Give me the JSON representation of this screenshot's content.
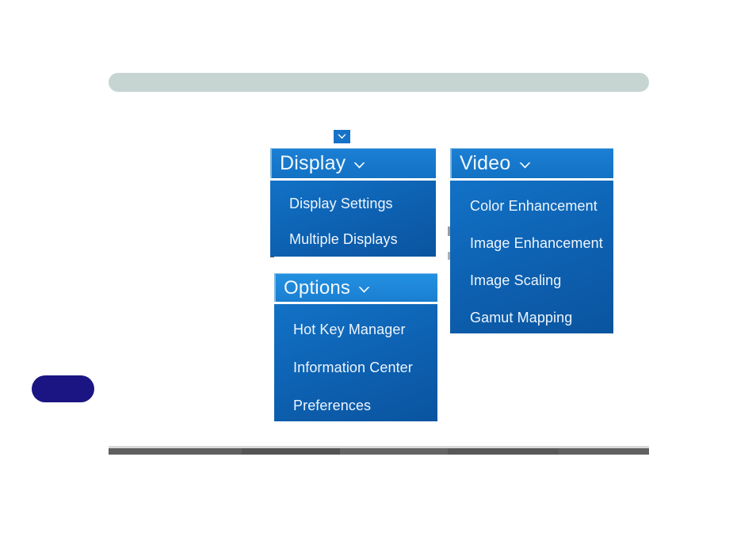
{
  "page": {
    "background_color": "#ffffff",
    "top_bar": {
      "color": "#c6d5d2",
      "label": ""
    },
    "bottom_rule": {
      "color": "#5a5a5a"
    },
    "nav_pill": {
      "color": "#1b1583",
      "label": ""
    }
  },
  "toggle_button": {
    "icon": "chevron-down-icon",
    "color": "#1572c8"
  },
  "menus": [
    {
      "id": "display",
      "title": "Display",
      "chevron_icon": "chevron-down-icon",
      "header_color": "#1778cb",
      "body_color": "#0e63b4",
      "items": [
        {
          "label": "Display Settings"
        },
        {
          "label": "Multiple Displays"
        }
      ]
    },
    {
      "id": "options",
      "title": "Options",
      "chevron_icon": "chevron-down-icon",
      "header_color": "#1e86d8",
      "body_color": "#0e63b4",
      "items": [
        {
          "label": "Hot Key Manager"
        },
        {
          "label": "Information Center"
        },
        {
          "label": "Preferences"
        }
      ]
    },
    {
      "id": "video",
      "title": "Video",
      "chevron_icon": "chevron-down-icon",
      "header_color": "#1778cb",
      "body_color": "#0e63b4",
      "items": [
        {
          "label": "Color Enhancement"
        },
        {
          "label": "Image Enhancement"
        },
        {
          "label": "Image Scaling"
        },
        {
          "label": "Gamut Mapping"
        }
      ]
    }
  ]
}
